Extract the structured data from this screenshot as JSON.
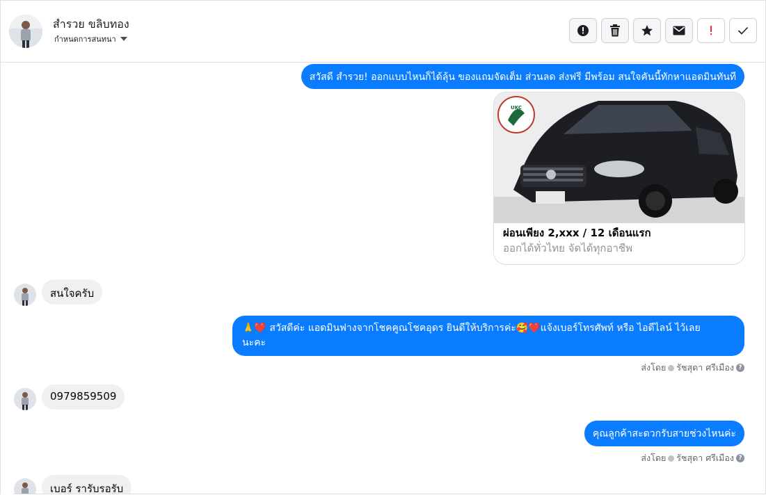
{
  "header": {
    "contact_name": "สำรวย ขลิบทอง",
    "assign_label": "กำหนดการสนทนา",
    "toolbar": [
      {
        "name": "mark-spam-button",
        "icon": "alert-circle-icon"
      },
      {
        "name": "delete-button",
        "icon": "trash-icon"
      },
      {
        "name": "star-button",
        "icon": "star-icon"
      },
      {
        "name": "mark-unread-button",
        "icon": "envelope-icon"
      },
      {
        "name": "follow-up-button",
        "icon": "exclamation-icon"
      },
      {
        "name": "mark-done-button",
        "icon": "check-icon"
      }
    ]
  },
  "messages": {
    "m1_text": "สวัสดี สำรวย! ออกแบบไหนก็ได้ลุ้น ของแถมจัดเต็ม ส่วนลด ส่งฟรี มีพร้อม สนใจคันนี้ทักหาแอดมินทันที",
    "card": {
      "logo_text": "UKC",
      "title": "ผ่อนเพียง 2,xxx / 12 เดือนแรก",
      "subtitle": "ออกได้ทั่วไทย จัดได้ทุกอาชีพ"
    },
    "m2_text": "สนใจครับ",
    "m3_line1": "🙏❤️ สวัสดีค่ะ แอดมินฟางจากโชคคูณโชคอุดร ยินดีให้บริการค่ะ🥰❤️แจ้งเบอร์โทรศัพท์ หรือ ไอดีไลน์  ไว้เลย",
    "m3_line2": "นะคะ",
    "sent_by_label": "ส่งโดย",
    "sent_by_name": "รัชสุดา ศรีเมือง",
    "m4_text": "0979859509",
    "m5_text": "คุณลูกค้าสะดวกรับสายช่วงไหนค่ะ",
    "m6_text": "เบอร์ รารับรอรับ"
  },
  "colors": {
    "outgoing_bubble": "#0a7cff",
    "incoming_bubble": "#f0f0f0",
    "divider": "#dddfe2"
  }
}
